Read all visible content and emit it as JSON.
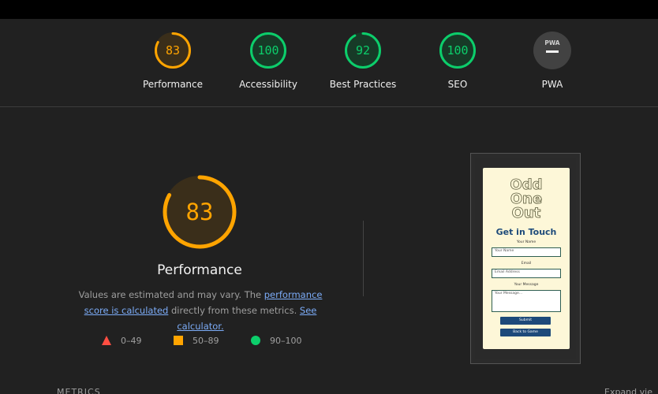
{
  "colors": {
    "average": "#ffa400",
    "pass": "#0cce6b",
    "fail": "#ff4e42",
    "na": "#5f6368",
    "link": "#7cacf8"
  },
  "categories": [
    {
      "label": "Performance",
      "score": "83",
      "value": 83,
      "rating": "average"
    },
    {
      "label": "Accessibility",
      "score": "100",
      "value": 100,
      "rating": "pass"
    },
    {
      "label": "Best Practices",
      "score": "92",
      "value": 92,
      "rating": "pass"
    },
    {
      "label": "SEO",
      "score": "100",
      "value": 100,
      "rating": "pass"
    },
    {
      "label": "PWA",
      "score": "",
      "value": null,
      "rating": "na",
      "badge_text": "PWA"
    }
  ],
  "performance": {
    "score": "83",
    "value": 83,
    "title": "Performance",
    "desc_prefix": "Values are estimated and may vary. The ",
    "desc_link1": "performance score is calculated",
    "desc_middle": " directly from these metrics. ",
    "desc_link2": "See calculator."
  },
  "legend": [
    {
      "shape": "triangle",
      "range": "0–49",
      "color": "#ff4e42"
    },
    {
      "shape": "square",
      "range": "50–89",
      "color": "#ffa400"
    },
    {
      "shape": "circle",
      "range": "90–100",
      "color": "#0cce6b"
    }
  ],
  "screenshot": {
    "logo_line1": "Odd",
    "logo_line2": "One",
    "logo_line3": "Out",
    "heading": "Get in Touch",
    "name_label": "Your Name",
    "name_placeholder": "Your Name",
    "email_label": "Email",
    "email_placeholder": "Email Address",
    "message_label": "Your Message",
    "message_placeholder": "Your Message...",
    "submit_label": "Submit",
    "back_label": "Back to Game"
  },
  "bottom": {
    "metrics_label": "METRICS",
    "expand_label": "Expand vie"
  }
}
